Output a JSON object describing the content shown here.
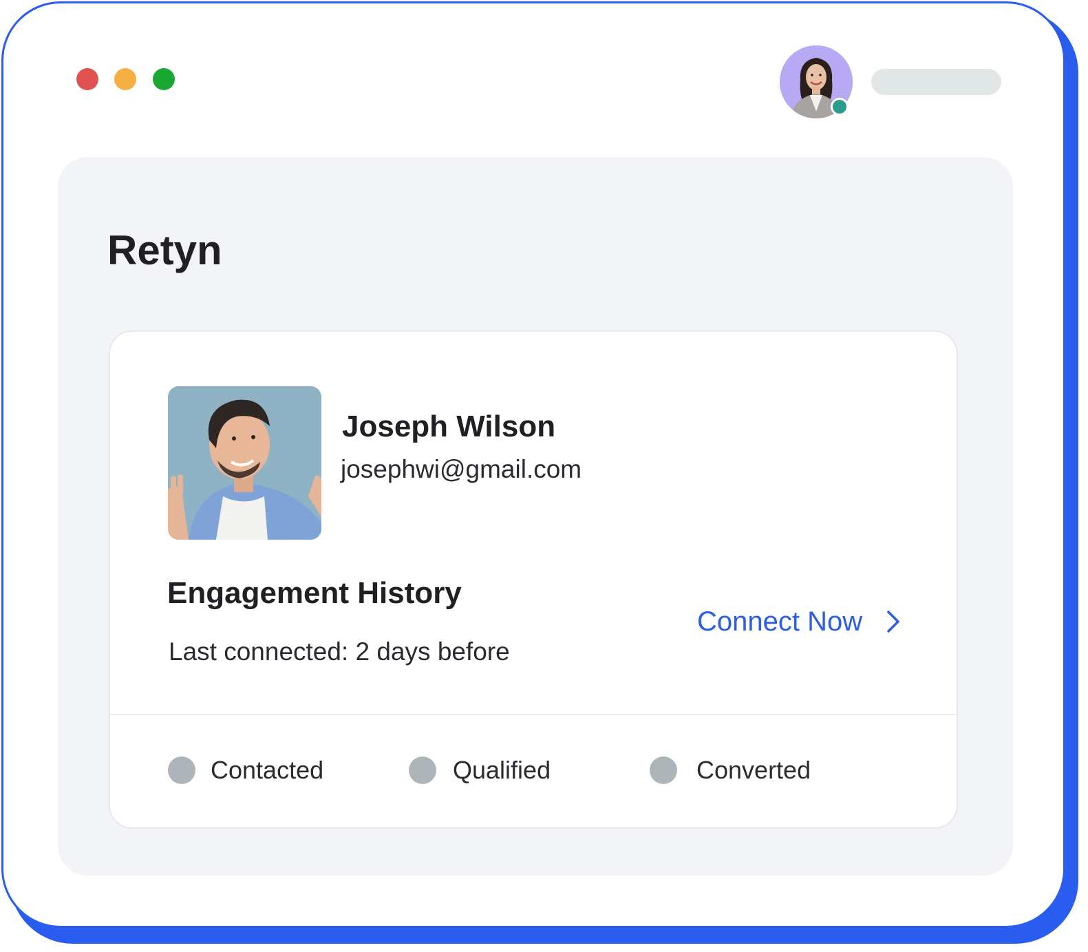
{
  "window": {
    "controls": [
      "close",
      "minimize",
      "maximize"
    ],
    "colors": {
      "close": "#e05252",
      "minimize": "#f5b041",
      "maximize": "#1aa832"
    }
  },
  "header": {
    "user_avatar": "user-avatar",
    "online_status_color": "#2a9d8f"
  },
  "app": {
    "title": "Retyn"
  },
  "contact": {
    "name": "Joseph Wilson",
    "email": "josephwi@gmail.com"
  },
  "engagement": {
    "heading": "Engagement History",
    "last_connected": "Last connected: 2 days before",
    "connect_label": "Connect Now",
    "connect_icon": "chevron-right-icon"
  },
  "pipeline": {
    "stages": [
      {
        "label": "Contacted"
      },
      {
        "label": "Qualified"
      },
      {
        "label": "Converted"
      }
    ]
  },
  "colors": {
    "accent": "#2b5cf0",
    "inactive_status": "#adb5b9"
  }
}
